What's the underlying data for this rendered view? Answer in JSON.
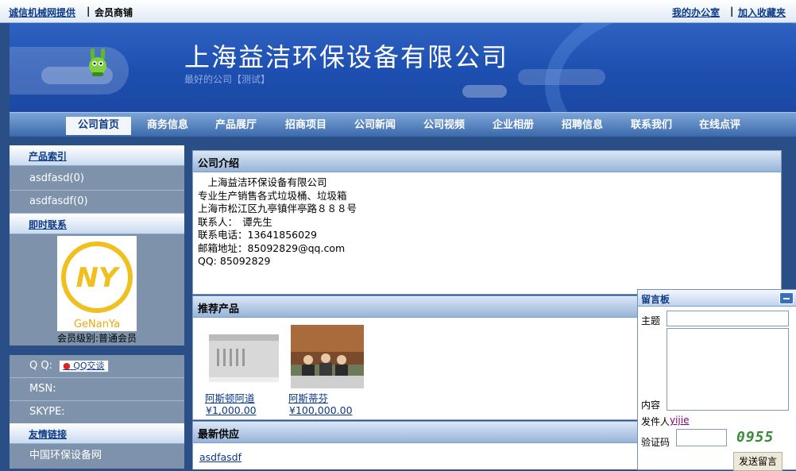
{
  "topbar": {
    "provider": "诚信机械网提供",
    "sep1": "|",
    "member_shop": "会员商铺",
    "my_office": "我的办公室",
    "sep2": "|",
    "add_favorite": "加入收藏夹"
  },
  "banner": {
    "company_name": "上海益洁环保设备有限公司",
    "slogan": "最好的公司【测试】"
  },
  "nav": {
    "items": [
      "公司首页",
      "商务信息",
      "产品展厅",
      "招商项目",
      "公司新闻",
      "公司视频",
      "企业相册",
      "招聘信息",
      "联系我们",
      "在线点评"
    ],
    "active_index": 0
  },
  "sidebar": {
    "product_index_title": "产品索引",
    "products": [
      "asdfasd(0)",
      "asdfasdf(0)"
    ],
    "contact_title": "即时联系",
    "member_level": "会员级别:普通会员",
    "logo_text": "GeNanYa",
    "qq_label": "Q Q:",
    "qq_button": "QQ交谈",
    "msn_label": "MSN:",
    "skype_label": "SKYPE:",
    "links_title": "友情链接",
    "links": [
      "中国环保设备网"
    ]
  },
  "intro": {
    "title": "公司介绍",
    "lines": [
      "　上海益洁环保设备有限公司",
      "专业生产销售各式垃圾桶、垃圾箱",
      "上海市松江区九亭镇伴亭路８８８号",
      "联系人：　谭先生",
      "联系电话：13641856029",
      "邮箱地址：85092829@qq.com",
      "QQ: 85092829"
    ]
  },
  "recommend": {
    "title": "推荐产品",
    "products": [
      {
        "name": "阿斯顿阿道",
        "price": "¥1,000.00"
      },
      {
        "name": "阿斯蒂芬",
        "price": "¥100,000.00"
      }
    ]
  },
  "supply": {
    "title": "最新供应",
    "items": [
      "asdfasdf"
    ]
  },
  "board": {
    "title": "留言板",
    "subject_label": "主题",
    "content_label": "内容",
    "sender_label": "发件人",
    "sender_value": "yijie",
    "captcha_label": "验证码",
    "captcha_text": "0955",
    "send_button": "发送留言"
  },
  "colors": {
    "nav_bg": "#3b6aac",
    "banner_bg": "#1d4fb0",
    "link": "#0c3a87",
    "sidebar_bg": "#7e93ab"
  }
}
